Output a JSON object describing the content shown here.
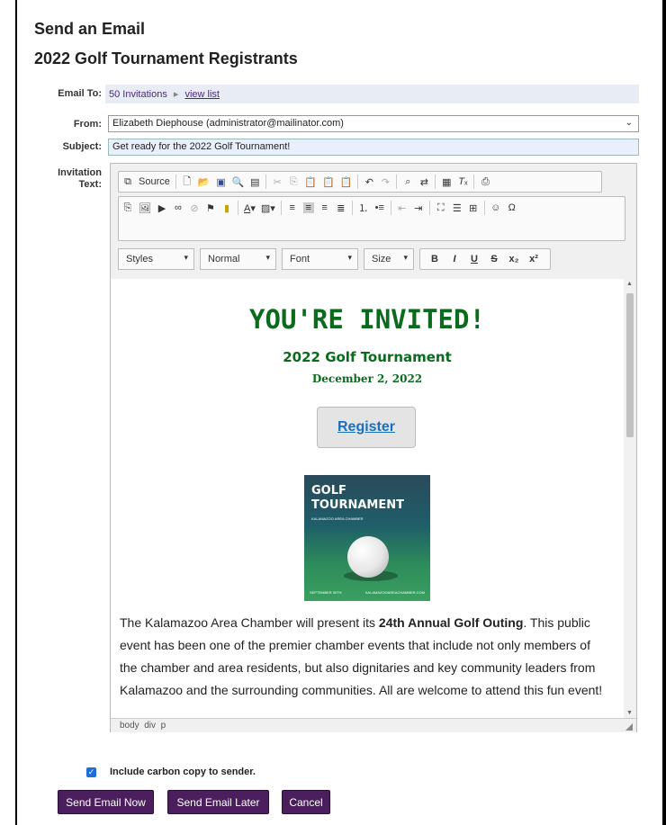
{
  "header": {
    "title": "Send an Email",
    "subtitle": "2022 Golf Tournament Registrants"
  },
  "form": {
    "email_to_label": "Email To:",
    "email_to_value": "50 Invitations",
    "view_list_link": "view list",
    "from_label": "From:",
    "from_value": "Elizabeth Diephouse (administrator@mailinator.com)",
    "subject_label": "Subject:",
    "subject_value": "Get ready for the 2022 Golf Tournament!",
    "invitation_label_1": "Invitation",
    "invitation_label_2": "Text:"
  },
  "toolbar": {
    "source_label": "Source",
    "styles_label": "Styles",
    "format_label": "Normal",
    "font_label": "Font",
    "size_label": "Size",
    "bold": "B",
    "italic": "I",
    "underline": "U",
    "strike": "S",
    "subscript": "x₂",
    "superscript": "x²"
  },
  "content": {
    "headline": "YOU'RE INVITED!",
    "event_title": "2022 Golf Tournament",
    "event_date": "December 2, 2022",
    "register_label": "Register",
    "image_title_1": "GOLF",
    "image_title_2": "TOURNAMENT",
    "image_sub": "KALAMAZOO AREA CHAMBER",
    "image_foot_left": "SEPTEMBER 30TH",
    "image_foot_right": "KALAMAZOOAREACHAMBER.COM",
    "para_before": "The Kalamazoo Area Chamber will present its ",
    "para_bold": "24th Annual Golf Outing",
    "para_after": ". This public event has been one of the premier chamber events that include not only members of the chamber and area residents, but also dignitaries and key community leaders from Kalamazoo and the surrounding communities. All are welcome to attend this fun event!"
  },
  "status_bar": {
    "path": "body  div  p"
  },
  "options": {
    "carbon_copy_label": "Include carbon copy to sender.",
    "carbon_copy_checked": true
  },
  "actions": {
    "send_now": "Send Email Now",
    "send_later": "Send Email Later",
    "cancel": "Cancel"
  },
  "colors": {
    "primary_button": "#4b1e5e",
    "heading_green": "#0a6b1d",
    "link_blue": "#1a6fc0"
  }
}
